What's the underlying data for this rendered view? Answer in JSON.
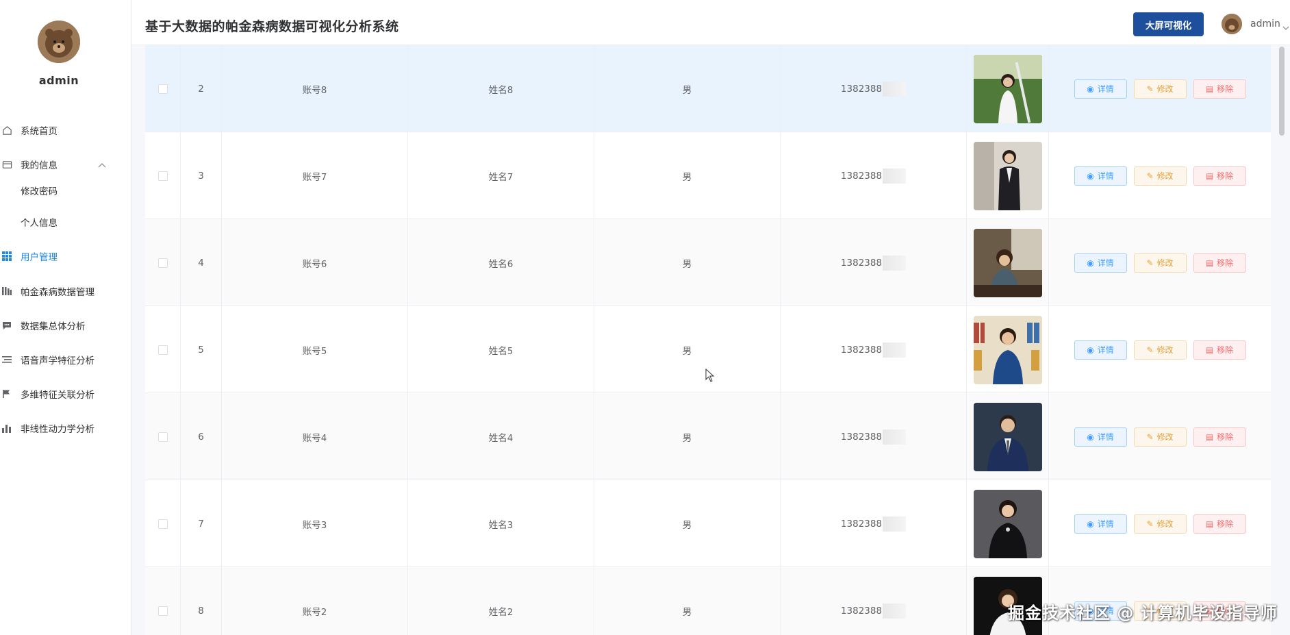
{
  "header": {
    "title": "基于大数据的帕金森病数据可视化分析系统",
    "bigscreen_label": "大屏可视化",
    "username": "admin"
  },
  "sidebar": {
    "username": "admin",
    "items": [
      {
        "label": "系统首页",
        "icon": "home-icon"
      },
      {
        "label": "我的信息",
        "icon": "card-icon",
        "expanded": true
      },
      {
        "label": "修改密码"
      },
      {
        "label": "个人信息"
      },
      {
        "label": "用户管理",
        "icon": "grid-icon",
        "active": true
      },
      {
        "label": "帕金森病数据管理",
        "icon": "library-icon"
      },
      {
        "label": "数据集总体分析",
        "icon": "chat-icon"
      },
      {
        "label": "语音声学特征分析",
        "icon": "list-icon"
      },
      {
        "label": "多维特征关联分析",
        "icon": "flag-icon"
      },
      {
        "label": "非线性动力学分析",
        "icon": "bar-chart-icon"
      }
    ]
  },
  "table": {
    "rows": [
      {
        "index": "2",
        "account": "账号8",
        "name": "姓名8",
        "gender": "男",
        "phone": "1382388"
      },
      {
        "index": "3",
        "account": "账号7",
        "name": "姓名7",
        "gender": "男",
        "phone": "1382388"
      },
      {
        "index": "4",
        "account": "账号6",
        "name": "姓名6",
        "gender": "男",
        "phone": "1382388"
      },
      {
        "index": "5",
        "account": "账号5",
        "name": "姓名5",
        "gender": "男",
        "phone": "1382388"
      },
      {
        "index": "6",
        "account": "账号4",
        "name": "姓名4",
        "gender": "男",
        "phone": "1382388"
      },
      {
        "index": "7",
        "account": "账号3",
        "name": "姓名3",
        "gender": "男",
        "phone": "1382388"
      },
      {
        "index": "8",
        "account": "账号2",
        "name": "姓名2",
        "gender": "男",
        "phone": "1382388"
      }
    ],
    "actions": {
      "detail": "详情",
      "edit": "修改",
      "delete": "移除"
    }
  },
  "watermark": "掘金技术社区 @ 计算机毕设指导师",
  "colors": {
    "accent": "#1e88e5",
    "bigscreen_button": "#1e4f9c",
    "highlight_row": "#e8f3fd"
  }
}
